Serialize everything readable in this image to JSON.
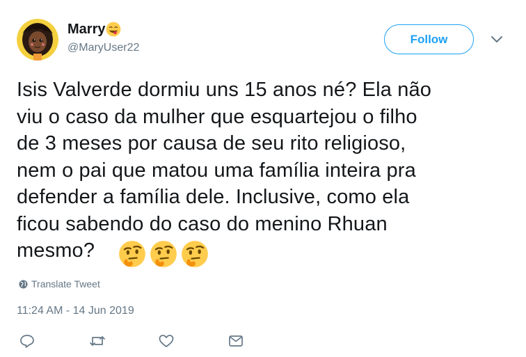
{
  "user": {
    "display_name": "Marry",
    "handle": "@MaryUser22",
    "name_emoji": "yum-emoji"
  },
  "follow_label": "Follow",
  "tweet": {
    "text": "Isis Valverde dormiu uns 15 anos né? Ela não\nviu o caso da mulher que esquartejou o filho\nde 3 meses por causa de seu rito religioso,\nnem o pai que matou uma família inteira pra\ndefender a família dele. Inclusive, como ela\nficou sabendo do caso do menino Rhuan\nmesmo?",
    "emojis": [
      "thinking-face",
      "thinking-face",
      "thinking-face"
    ]
  },
  "translate_label": "Translate Tweet",
  "timestamp": "11:24 AM - 14 Jun 2019",
  "actions": [
    "reply-icon",
    "retweet-icon",
    "like-icon",
    "direct-message-icon"
  ],
  "colors": {
    "accent": "#1da1f2",
    "text": "#14171a",
    "secondary": "#657786"
  }
}
